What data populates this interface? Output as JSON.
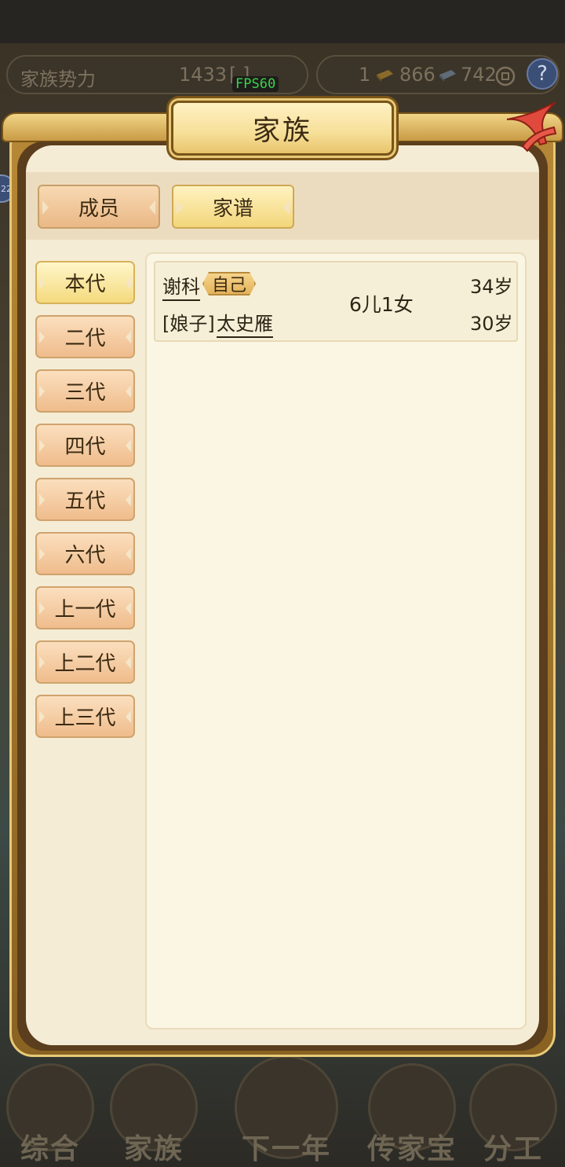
{
  "background": {
    "family_power_label": "家族势力",
    "family_power_value": "1433",
    "family_power_extra": "[    ]",
    "resource_1": "1",
    "resource_gold": "866",
    "resource_silver": "742",
    "help_icon": "question-icon",
    "fps": "FPS60",
    "side_badge": "22",
    "nav": [
      "综合",
      "家族",
      "下一年",
      "传家宝",
      "分工"
    ]
  },
  "dialog": {
    "title": "家族",
    "close_icon": "close-icon",
    "tabs": [
      {
        "label": "成员",
        "active": false
      },
      {
        "label": "家谱",
        "active": true
      }
    ],
    "generations": [
      {
        "label": "本代",
        "active": true
      },
      {
        "label": "二代",
        "active": false
      },
      {
        "label": "三代",
        "active": false
      },
      {
        "label": "四代",
        "active": false
      },
      {
        "label": "五代",
        "active": false
      },
      {
        "label": "六代",
        "active": false
      },
      {
        "label": "上一代",
        "active": false
      },
      {
        "label": "上二代",
        "active": false
      },
      {
        "label": "上三代",
        "active": false
      }
    ],
    "family_entry": {
      "husband_name": "谢科",
      "self_tag": "自己",
      "husband_age": "34岁",
      "wife_prefix": "[娘子]",
      "wife_name": "太史雁",
      "wife_age": "30岁",
      "children": "6儿1女"
    }
  },
  "colors": {
    "panel": "#f5ecd5",
    "frame_gold": "#b68836",
    "active_button": "#f4da7e",
    "inactive_button": "#efbc8c",
    "text": "#3b2a12"
  }
}
